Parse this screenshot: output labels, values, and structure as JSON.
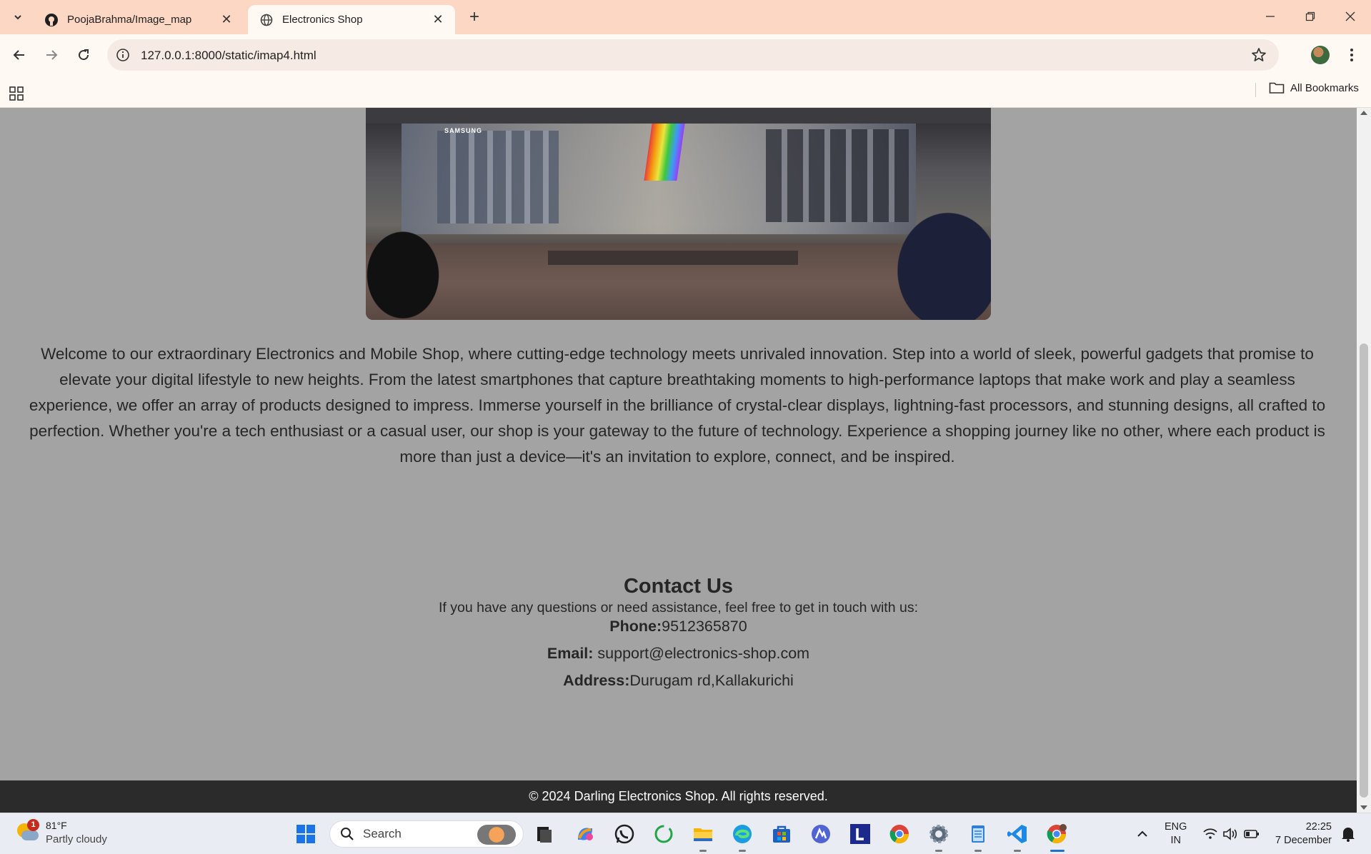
{
  "browser": {
    "tabs": [
      {
        "title": "PoojaBrahma/Image_map",
        "active": false
      },
      {
        "title": "Electronics Shop",
        "active": true
      }
    ],
    "url": "127.0.0.1:8000/static/imap4.html",
    "bookmarks_label": "All Bookmarks"
  },
  "page": {
    "image_brand_text": "SAMSUNG",
    "welcome_text": "Welcome to our extraordinary Electronics and Mobile Shop, where cutting-edge technology meets unrivaled innovation. Step into a world of sleek, powerful gadgets that promise to elevate your digital lifestyle to new heights. From the latest smartphones that capture breathtaking moments to high-performance laptops that make work and play a seamless experience, we offer an array of products designed to impress. Immerse yourself in the brilliance of crystal-clear displays, lightning-fast processors, and stunning designs, all crafted to perfection. Whether you're a tech enthusiast or a casual user, our shop is your gateway to the future of technology. Experience a shopping journey like no other, where each product is more than just a device—it's an invitation to explore, connect, and be inspired.",
    "contact": {
      "heading": "Contact Us",
      "intro": "If you have any questions or need assistance, feel free to get in touch with us:",
      "phone_label": "Phone:",
      "phone_value": "9512365870",
      "email_label": "Email:",
      "email_value": " support@electronics-shop.com",
      "address_label": "Address:",
      "address_value": "Durugam rd,Kallakurichi"
    },
    "footer_text": "© 2024 Darling Electronics Shop. All rights reserved."
  },
  "taskbar": {
    "weather_temp": "81°F",
    "weather_condition": "Partly cloudy",
    "weather_badge": "1",
    "search_placeholder": "Search",
    "lang_line1": "ENG",
    "lang_line2": "IN",
    "time": "22:25",
    "date": "7 December",
    "pinned_apps": [
      "start-icon",
      "task-view-icon",
      "copilot-icon",
      "whatsapp-icon",
      "refresh-app-icon",
      "file-explorer-icon",
      "edge-icon",
      "store-icon",
      "vpn-icon",
      "l-app-icon",
      "chrome-icon",
      "settings-icon",
      "notepad-icon",
      "vscode-icon",
      "chrome-profile-icon"
    ]
  },
  "colors": {
    "tab_strip": "#fcd7c4",
    "toolbar": "#fff8f3",
    "page_background": "#a3a3a3",
    "footer": "#2b2b2b",
    "text": "#262626"
  }
}
